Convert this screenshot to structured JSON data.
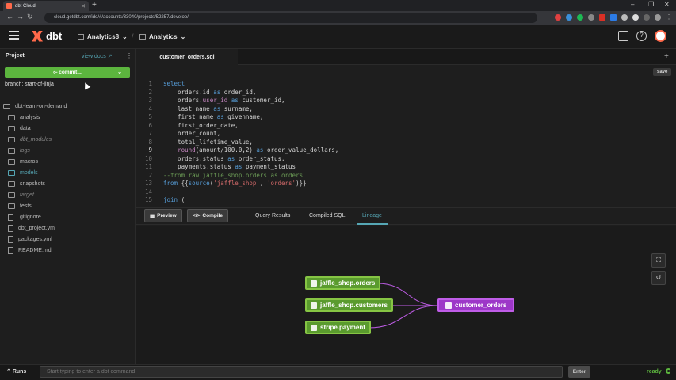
{
  "browser": {
    "tab_title": "dbt Cloud",
    "url": "cloud.getdbt.com/ide/#/accounts/33040/projects/52257/develop/"
  },
  "header": {
    "logo_text": "dbt",
    "account": "Analytics8",
    "project": "Analytics"
  },
  "sidebar": {
    "title": "Project",
    "view_docs": "view docs",
    "commit_label": "commit...",
    "branch": "branch: start-of-jinja",
    "root": "dbt-learn-on-demand",
    "items": [
      {
        "label": "analysis",
        "type": "folder"
      },
      {
        "label": "data",
        "type": "folder"
      },
      {
        "label": "dbt_modules",
        "type": "folder"
      },
      {
        "label": "logs",
        "type": "folder"
      },
      {
        "label": "macros",
        "type": "folder"
      },
      {
        "label": "models",
        "type": "folder"
      },
      {
        "label": "snapshots",
        "type": "folder"
      },
      {
        "label": "target",
        "type": "folder"
      },
      {
        "label": "tests",
        "type": "folder"
      },
      {
        "label": ".gitignore",
        "type": "file"
      },
      {
        "label": "dbt_project.yml",
        "type": "file"
      },
      {
        "label": "packages.yml",
        "type": "file"
      },
      {
        "label": "README.md",
        "type": "file"
      }
    ]
  },
  "editor": {
    "tab": "customer_orders.sql",
    "save": "save",
    "lines": [
      "1",
      "2",
      "3",
      "4",
      "5",
      "6",
      "7",
      "8",
      "9",
      "10",
      "11",
      "12",
      "13",
      "14",
      "15"
    ]
  },
  "toolbar": {
    "preview": "Preview",
    "compile": "Compile",
    "tabs": [
      "Query Results",
      "Compiled SQL",
      "Lineage"
    ]
  },
  "lineage": {
    "sources": [
      "jaffle_shop.orders",
      "jaffle_shop.customers",
      "stripe.payment"
    ],
    "model": "customer_orders"
  },
  "footer": {
    "runs": "Runs",
    "placeholder": "Start typing to enter a dbt command",
    "enter": "Enter",
    "status": "ready"
  },
  "colors": {
    "accent": "#ff694a",
    "source_node": "#5a9b2e",
    "model_node": "#9d37c8",
    "link": "#56a7b5"
  }
}
